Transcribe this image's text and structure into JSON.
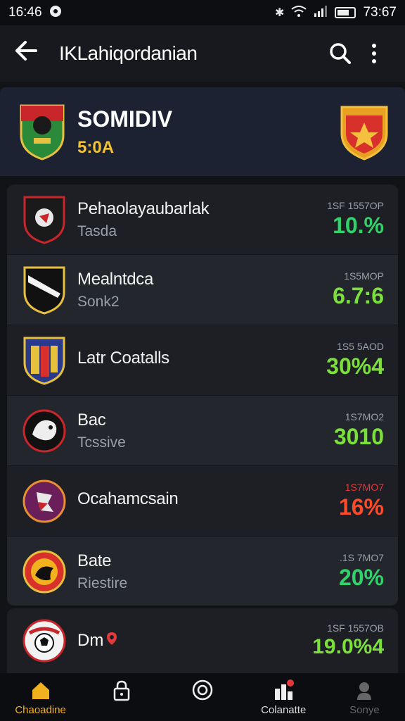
{
  "status_bar": {
    "time": "16:46",
    "clock_right": "73:67"
  },
  "app_bar": {
    "title": "IKLahiqordanian"
  },
  "hero": {
    "team_name": "SOMIDIV",
    "score": "5:0A"
  },
  "teams": [
    {
      "name": "Pehaolayaubarlak",
      "sub": "Tasda",
      "small": "1SF 1557OP",
      "pct": "10.%",
      "color": "#2fd36a",
      "logo": "black-red"
    },
    {
      "name": "Mealntdca",
      "sub": "Sonk2",
      "small": "1S5MOP",
      "pct": "6.7:6",
      "color": "#7be03a",
      "logo": "yellow-black"
    },
    {
      "name": "Latr Coatalls",
      "sub": "",
      "small": "1S5 5AOD",
      "pct": "30%4",
      "color": "#7be03a",
      "logo": "red-yellow-blue"
    },
    {
      "name": "Bac",
      "sub": "Tcssive",
      "small": "1S7MO2",
      "pct": "3010",
      "color": "#7be03a",
      "logo": "dark-white"
    },
    {
      "name": "Ocahamcsain",
      "sub": "",
      "small": "1S7MO7",
      "pct": "16%",
      "color": "#ff4a2a",
      "logo": "purple-red"
    },
    {
      "name": "Bate",
      "sub": "Riestire",
      "small": ".1S 7MO7",
      "pct": "20%",
      "color": "#2fd36a",
      "logo": "red-yellow"
    }
  ],
  "last_team": {
    "name": "Dm",
    "small": "1SF 1557OB",
    "pct": "19.0%4",
    "color": "#7be03a"
  },
  "nav": [
    {
      "label": "Chaoadine",
      "icon": "home-icon"
    },
    {
      "label": "",
      "icon": "lock-icon"
    },
    {
      "label": "",
      "icon": "target-icon"
    },
    {
      "label": "Colanatte",
      "icon": "chart-icon"
    },
    {
      "label": "Sonye",
      "icon": "profile-icon"
    }
  ],
  "colors": {
    "accent": "#f2b21e",
    "hero_bg": "#1d2232",
    "positive": "#2fd36a",
    "negative": "#ff4a2a"
  }
}
